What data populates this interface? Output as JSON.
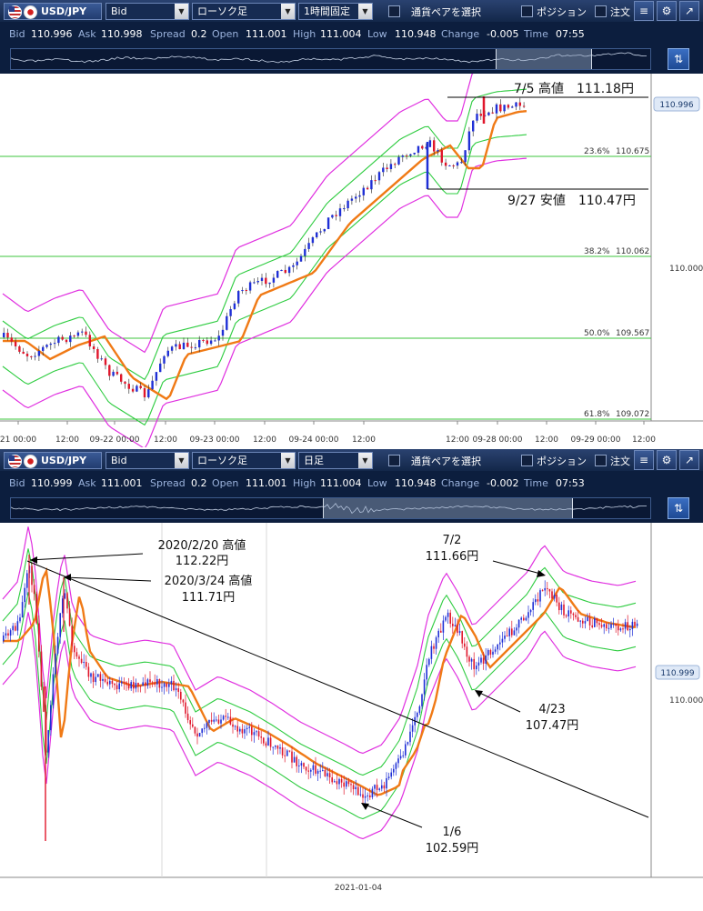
{
  "top": {
    "toolbar": {
      "symbol": "USD/JPY",
      "price_type": "Bid",
      "chart_type": "ローソク足",
      "timeframe": "1時間固定",
      "select_pair": "通貨ペアを選択",
      "position": "ポジション",
      "order": "注文"
    },
    "info": {
      "bid_label": "Bid",
      "bid": "110.996",
      "ask_label": "Ask",
      "ask": "110.998",
      "spread_label": "Spread",
      "spread": "0.2",
      "open_label": "Open",
      "open": "111.001",
      "high_label": "High",
      "high": "111.004",
      "low_label": "Low",
      "low": "110.948",
      "change_label": "Change",
      "change": "-0.005",
      "time_label": "Time",
      "time": "07:55"
    },
    "chart": {
      "annotation_high": "7/5 高値　111.18円",
      "annotation_low": "9/27 安値　110.47円",
      "fib_levels": [
        {
          "label": "23.6%",
          "value": "110.675"
        },
        {
          "label": "38.2%",
          "value": "110.062"
        },
        {
          "label": "50.0%",
          "value": "109.567"
        },
        {
          "label": "61.8%",
          "value": "109.072"
        }
      ],
      "y_ticks": [
        "110.000"
      ],
      "price_tag": "110.996",
      "x_ticks": [
        "21 00:00",
        "12:00",
        "09-22 00:00",
        "12:00",
        "09-23 00:00",
        "12:00",
        "09-24 00:00",
        "12:00",
        "12:00",
        "09-28 00:00",
        "12:00",
        "09-29 00:00",
        "12:00"
      ]
    }
  },
  "bottom": {
    "toolbar": {
      "symbol": "USD/JPY",
      "price_type": "Bid",
      "chart_type": "ローソク足",
      "timeframe": "日足",
      "select_pair": "通貨ペアを選択",
      "position": "ポジション",
      "order": "注文"
    },
    "info": {
      "bid_label": "Bid",
      "bid": "110.999",
      "ask_label": "Ask",
      "ask": "111.001",
      "spread_label": "Spread",
      "spread": "0.2",
      "open_label": "Open",
      "open": "111.001",
      "high_label": "High",
      "high": "111.004",
      "low_label": "Low",
      "low": "110.948",
      "change_label": "Change",
      "change": "-0.002",
      "time_label": "Time",
      "time": "07:53"
    },
    "chart": {
      "ann_feb_date": "2020/2/20 高値",
      "ann_feb_price": "112.22円",
      "ann_mar_date": "2020/3/24 高値",
      "ann_mar_price": "111.71円",
      "ann_jul_date": "7/2",
      "ann_jul_price": "111.66円",
      "ann_apr_date": "4/23",
      "ann_apr_price": "107.47円",
      "ann_jan_date": "1/6",
      "ann_jan_price": "102.59円",
      "y_ticks": [
        "110.000"
      ],
      "price_tag": "110.999",
      "x_ticks": [
        "2021-01-04"
      ]
    }
  },
  "colors": {
    "toolbar_bg": "#1a3260",
    "bull": "#1f2fd6",
    "bear": "#e0162b",
    "ma_mid": "#f07a16",
    "band_inner": "#2ecc40",
    "band_outer": "#e030e0",
    "fib_line": "#3cc43c"
  }
}
